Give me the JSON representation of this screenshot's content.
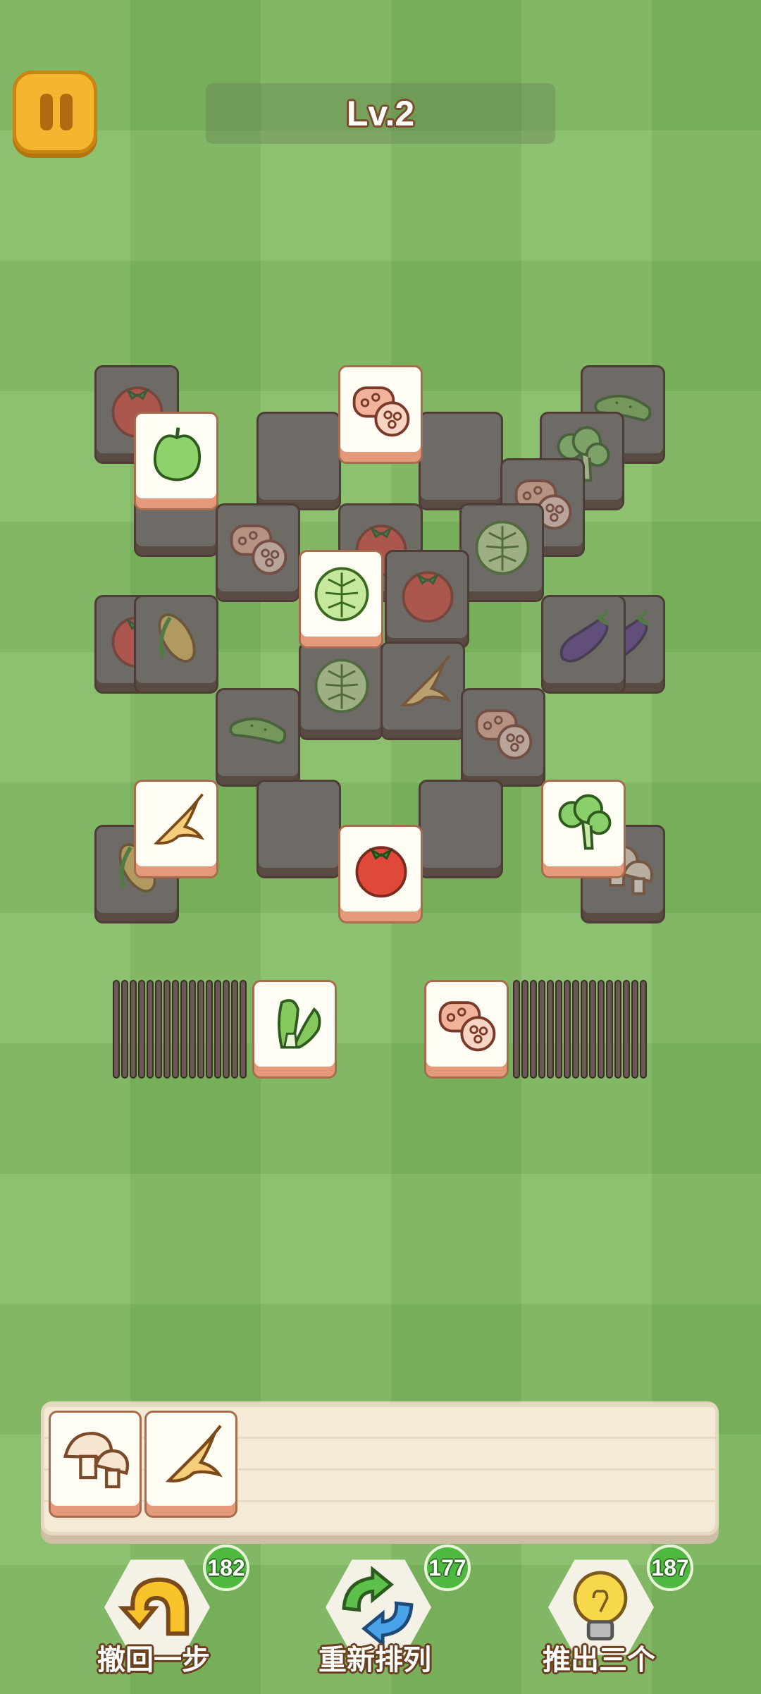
{
  "level": {
    "label": "Lv.2"
  },
  "pause": {
    "icon": "pause-icon"
  },
  "board": {
    "active_tiles": [
      {
        "item": "pepper-icon"
      },
      {
        "item": "lotus-root-icon"
      },
      {
        "item": "lettuce-icon"
      },
      {
        "item": "ginseng-icon"
      },
      {
        "item": "tomato-icon"
      },
      {
        "item": "broccoli-icon"
      }
    ],
    "dim_tiles": [
      {
        "item": "tomato-icon"
      },
      {
        "item": "cucumber-icon"
      },
      {
        "item": "broccoli-icon"
      },
      {
        "item": "lotus-root-icon"
      },
      {
        "item": "lettuce-icon"
      },
      {
        "item": "tomato-icon"
      },
      {
        "item": "corn-icon"
      },
      {
        "item": "eggplant-icon"
      },
      {
        "item": "lettuce-icon"
      },
      {
        "item": "ginseng-icon"
      },
      {
        "item": "cucumber-icon"
      },
      {
        "item": "lotus-root-icon"
      },
      {
        "item": "corn-icon"
      },
      {
        "item": "mushroom-icon"
      }
    ]
  },
  "side_stacks": {
    "left_top": "bok-choy-icon",
    "right_top": "lotus-root-icon"
  },
  "tray": {
    "slots": [
      "mushroom-icon",
      "ginseng-icon"
    ]
  },
  "tools": [
    {
      "label": "撤回一步",
      "count": "182",
      "icon": "undo-arrow-icon",
      "color": "#f6c42a"
    },
    {
      "label": "重新排列",
      "count": "177",
      "icon": "shuffle-icon",
      "color": "#4aa3e8"
    },
    {
      "label": "推出三个",
      "count": "187",
      "icon": "lightbulb-icon",
      "color": "#f7d84a"
    }
  ],
  "colors": {
    "accent": "#f4b52f",
    "badge": "#4fb840",
    "tile_bottom": "#e49a7a"
  }
}
